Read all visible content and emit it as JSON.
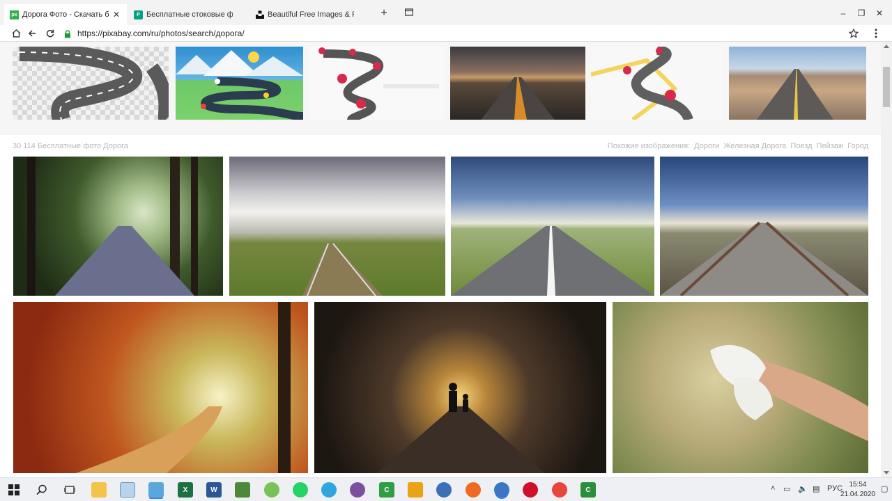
{
  "browser": {
    "tabs": [
      {
        "title": "Дорога Фото - Скачать бес",
        "favicon": "px",
        "favicon_color": "#2eb14a",
        "active": true
      },
      {
        "title": "Бесплатные стоковые фото - Р",
        "favicon": "P",
        "favicon_color": "#07a081",
        "active": false
      },
      {
        "title": "Beautiful Free Images & Picture",
        "favicon": "",
        "favicon_color": "#111111",
        "active": false
      }
    ],
    "new_tab": "+",
    "address": "https://pixabay.com/ru/photos/search/дорога/"
  },
  "page": {
    "results_count": "30 114 Бесплатные фото Дорога",
    "related_label": "Похожие изображения:",
    "related_tags": [
      "Дороги",
      "Железная Дорога",
      "Поезд",
      "Пейзаж",
      "Город"
    ]
  },
  "taskbar": {
    "language": "РУС",
    "time": "15:54",
    "date": "21.04.2020",
    "apps": [
      "start",
      "search",
      "task-view",
      "file-explorer",
      "notepad",
      "paint",
      "excel",
      "word",
      "archive",
      "android",
      "whatsapp",
      "telegram",
      "viber",
      "camtasia",
      "java",
      "thunderbird",
      "firefox",
      "browser",
      "opera",
      "chrome",
      "camtasia-recorder"
    ]
  },
  "colors": {
    "accent": "#2eb14a",
    "muted_text": "#b7b7b7"
  }
}
